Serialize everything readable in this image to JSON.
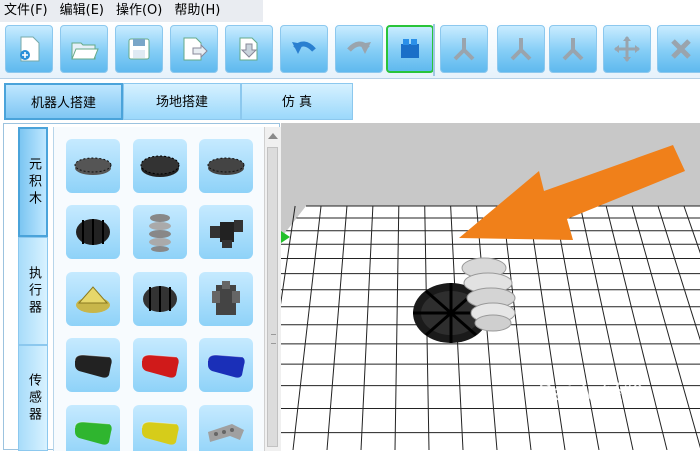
{
  "menubar": {
    "items": [
      "文件(F)",
      "编辑(E)",
      "操作(O)",
      "帮助(H)"
    ]
  },
  "toolbar": {
    "buttons": [
      {
        "icon": "new-file-icon"
      },
      {
        "icon": "open-folder-icon"
      },
      {
        "icon": "save-icon"
      },
      {
        "icon": "export-icon"
      },
      {
        "icon": "import-icon"
      },
      {
        "icon": "undo-icon"
      },
      {
        "icon": "redo-icon"
      },
      {
        "icon": "build-blocks-icon",
        "active": true
      },
      {
        "icon": "axis-icon"
      },
      {
        "icon": "axis-icon"
      },
      {
        "icon": "axis-icon"
      },
      {
        "icon": "move-icon"
      },
      {
        "icon": "delete-icon"
      }
    ]
  },
  "tabs": [
    "机器人搭建",
    "场地搭建",
    "仿 真"
  ],
  "side_tabs": [
    "元积木",
    "执行器",
    "传感器"
  ],
  "parts": [
    {
      "icon": "gear-flat-icon",
      "color": "#555555"
    },
    {
      "icon": "gear-wide-icon",
      "color": "#222222"
    },
    {
      "icon": "gear-flat-icon",
      "color": "#444444"
    },
    {
      "icon": "gear-barrel-icon",
      "color": "#222222"
    },
    {
      "icon": "worm-gear-icon",
      "color": "#888888"
    },
    {
      "icon": "connector-icon",
      "color": "#333333"
    },
    {
      "icon": "bevel-gear-icon",
      "color": "#c8b64a"
    },
    {
      "icon": "gear-barrel-icon",
      "color": "#333333"
    },
    {
      "icon": "hub-icon",
      "color": "#444444"
    },
    {
      "icon": "beam-icon",
      "color": "#222222"
    },
    {
      "icon": "beam-icon",
      "color": "#d01a1a"
    },
    {
      "icon": "beam-icon",
      "color": "#1a2fb8"
    },
    {
      "icon": "beam-icon",
      "color": "#2fb52f"
    },
    {
      "icon": "beam-icon",
      "color": "#d6cc1a"
    },
    {
      "icon": "beam-angled-icon",
      "color": "#a0a0a0"
    }
  ],
  "watermark": "Baidu经验",
  "colors": {
    "arrow": "#f0801a",
    "grid_line": "#222222",
    "floor": "#ffffff",
    "sky": "#c8c8c8",
    "marker": "#22c02a"
  }
}
